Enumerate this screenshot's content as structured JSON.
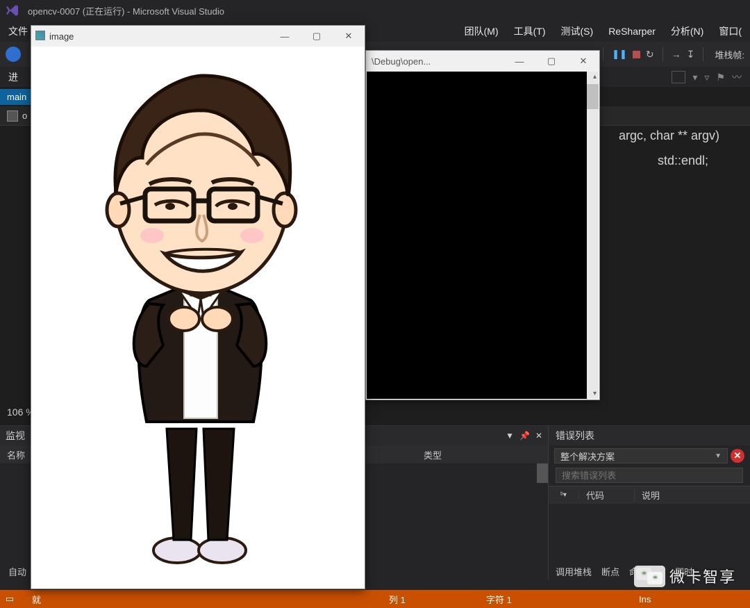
{
  "window_title": "opencv-0007 (正在运行) - Microsoft Visual Studio",
  "menu": {
    "file": "文件",
    "team": "团队(M)",
    "tools": "工具(T)",
    "test": "测试(S)",
    "resharper": "ReSharper",
    "analyze": "分析(N)",
    "window": "窗口("
  },
  "toolbar": {
    "process_prefix": "进",
    "stack_label": "堆栈帧:"
  },
  "editor": {
    "tab_label": "main",
    "file_label": "o",
    "code_right_1": "argc, char ** argv)",
    "code_right_2": "std::endl;",
    "zoom": "106 %"
  },
  "panels": {
    "watch_title": "监视",
    "watch_col_name": "名称",
    "watch_col_type": "类型",
    "watch_tab_auto": "自动",
    "errors_title": "错误列表",
    "errors_combo": "整个解决方案",
    "errors_search_placeholder": "搜索错误列表",
    "errors_col_code": "代码",
    "errors_col_desc": "说明",
    "errors_tab_callstack": "调用堆栈",
    "errors_tab_breakpoints": "断点",
    "errors_tab_command": "命令窗口",
    "errors_tab_immediate": "即时"
  },
  "status": {
    "ready": "就",
    "col": "列 1",
    "char": "字符 1",
    "ins": "Ins"
  },
  "image_window": {
    "title": "image"
  },
  "console_window": {
    "title": "\\Debug\\open..."
  },
  "watermark": "微卡智享"
}
